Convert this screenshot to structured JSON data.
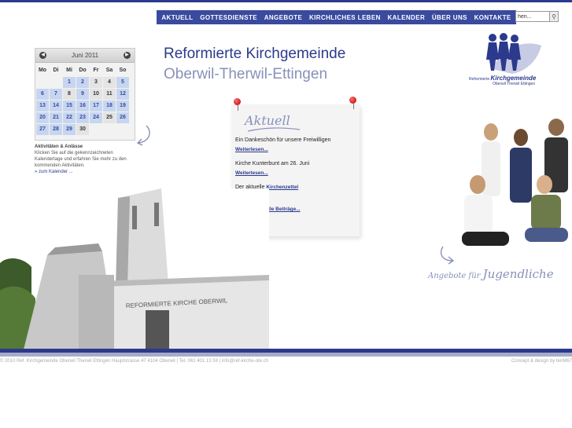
{
  "nav": {
    "items": [
      "AKTUELL",
      "GOTTESDIENSTE",
      "ANGEBOTE",
      "KIRCHLICHES LEBEN",
      "KALENDER",
      "ÜBER UNS",
      "KONTAKTE"
    ]
  },
  "search": {
    "value": "hen..."
  },
  "header": {
    "title": "Reformierte Kirchgemeinde",
    "subtitle": "Oberwil-Therwil-Ettingen"
  },
  "logo": {
    "line1_small": "Reformierte",
    "line1_big": "Kirchgemeinde",
    "line2": "Oberwil Therwil Ettingen"
  },
  "calendar": {
    "month": "Juni 2011",
    "weekdays": [
      "Mo",
      "Di",
      "Mi",
      "Do",
      "Fr",
      "Sa",
      "So"
    ],
    "info_title": "Aktivitäten & Anlässe",
    "info_text": "Klicken Sie auf die gekennzeichneten Kalendertage und erfahren Sie mehr zu den kommenden Aktivitäten.",
    "info_link": "» zum Kalender ..."
  },
  "news": {
    "title": "Aktuell",
    "item1_text": "Ein Dankeschön für unsere Freiwilligen",
    "item1_link": "Weiterlesen...",
    "item2_text": "Kirche Kunterbunt am 26. Juni",
    "item2_link": "Weiterlesen...",
    "item3_text": "Der aktuelle",
    "item3_link": "Kirchenzettel",
    "more_link": "Weitere aktuelle Beiträge..."
  },
  "church": {
    "sign": "REFORMIERTE KIRCHE OBERWIL"
  },
  "youth": {
    "label_small": "Angebote für",
    "label_big": "Jugendliche"
  },
  "footer": {
    "left": "© 2010 Ref. Kirchgemeinde Oberwil Therwil Ettingen Hauptstrasse 47 4104 Oberwil | Tel. 061 401 13 59 | info@ref-kirche-ote.ch",
    "right": "Concept & design by tenM67"
  },
  "colors": {
    "brand": "#2b3a8c",
    "accent_light": "#8890b8",
    "event_day": "#c7d6f0"
  }
}
